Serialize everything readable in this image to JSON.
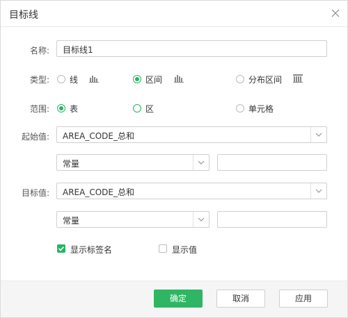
{
  "dialog": {
    "title": "目标线"
  },
  "form": {
    "name_label": "名称:",
    "name_value": "目标线1",
    "type_label": "类型:",
    "type_options": [
      {
        "label": "线",
        "selected": false,
        "icon": "bar-chart-icon"
      },
      {
        "label": "区间",
        "selected": true,
        "icon": "bar-chart-icon"
      },
      {
        "label": "分布区间",
        "selected": false,
        "icon": "distribution-chart-icon"
      }
    ],
    "scope_label": "范围:",
    "scope_options": [
      {
        "label": "表",
        "selected": true
      },
      {
        "label": "区",
        "selected": false
      },
      {
        "label": "单元格",
        "selected": false
      }
    ],
    "start_label": "起始值:",
    "start_field": "AREA_CODE_总和",
    "start_mode": "常量",
    "start_const": "",
    "target_label": "目标值:",
    "target_field": "AREA_CODE_总和",
    "target_mode": "常量",
    "target_const": "",
    "show_label_name": "显示标签名",
    "show_label_checked": true,
    "show_value": "显示值",
    "show_value_checked": false
  },
  "footer": {
    "ok": "确定",
    "cancel": "取消",
    "apply": "应用"
  },
  "colors": {
    "accent": "#2fb563",
    "border": "#cfcfcf"
  }
}
